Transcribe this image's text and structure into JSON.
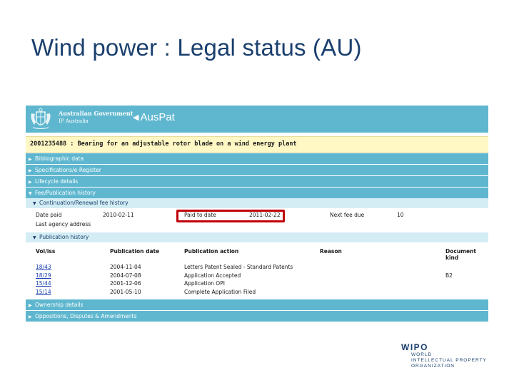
{
  "slide": {
    "title": "Wind power : Legal status (AU)"
  },
  "banner": {
    "gov_name": "Australian Government",
    "gov_sub": "IP Australia",
    "app_name": "AusPat",
    "crest_icon": "coat-of-arms-icon"
  },
  "patent": {
    "title": "2001235488 : Bearing for an adjustable rotor blade on a wind energy plant"
  },
  "sections": {
    "bibliographic": "Bibliographic data",
    "specifications": "Specifications/e-Register",
    "lifecycle": "Lifecycle details",
    "fee": "Fee/Publication history",
    "ownership": "Ownership details",
    "oppositions": "Oppositions, Disputes & Amendments"
  },
  "fee_history": {
    "title": "Continuation/Renewal fee history",
    "date_paid_label": "Date paid",
    "date_paid_value": "2010-02-11",
    "paid_to_label": "Paid to date",
    "paid_to_value": "2011-02-22",
    "next_fee_label": "Next fee due",
    "next_fee_value": "10",
    "agency_label": "Last agency address"
  },
  "publication_history": {
    "title": "Publication history",
    "columns": [
      "Vol/iss",
      "Publication date",
      "Publication action",
      "Reason",
      "Document kind"
    ],
    "rows": [
      {
        "vol": "18/43",
        "date": "2004-11-04",
        "action": "Letters Patent Sealed - Standard Patents",
        "reason": "",
        "kind": ""
      },
      {
        "vol": "18/29",
        "date": "2004-07-08",
        "action": "Application Accepted",
        "reason": "",
        "kind": "B2"
      },
      {
        "vol": "15/44",
        "date": "2001-12-06",
        "action": "Application OPI",
        "reason": "",
        "kind": ""
      },
      {
        "vol": "15/14",
        "date": "2001-05-10",
        "action": "Complete Application Filed",
        "reason": "",
        "kind": ""
      }
    ]
  },
  "wipo": {
    "name": "WIPO",
    "line1": "WORLD",
    "line2": "INTELLECTUAL PROPERTY",
    "line3": "ORGANIZATION"
  },
  "colors": {
    "section_bar": "#5fb7cf",
    "subsection_bar": "#d4edf4",
    "title_bar": "#fff7c4",
    "highlight_box": "#c0000b",
    "slide_title": "#1a3f6e"
  }
}
